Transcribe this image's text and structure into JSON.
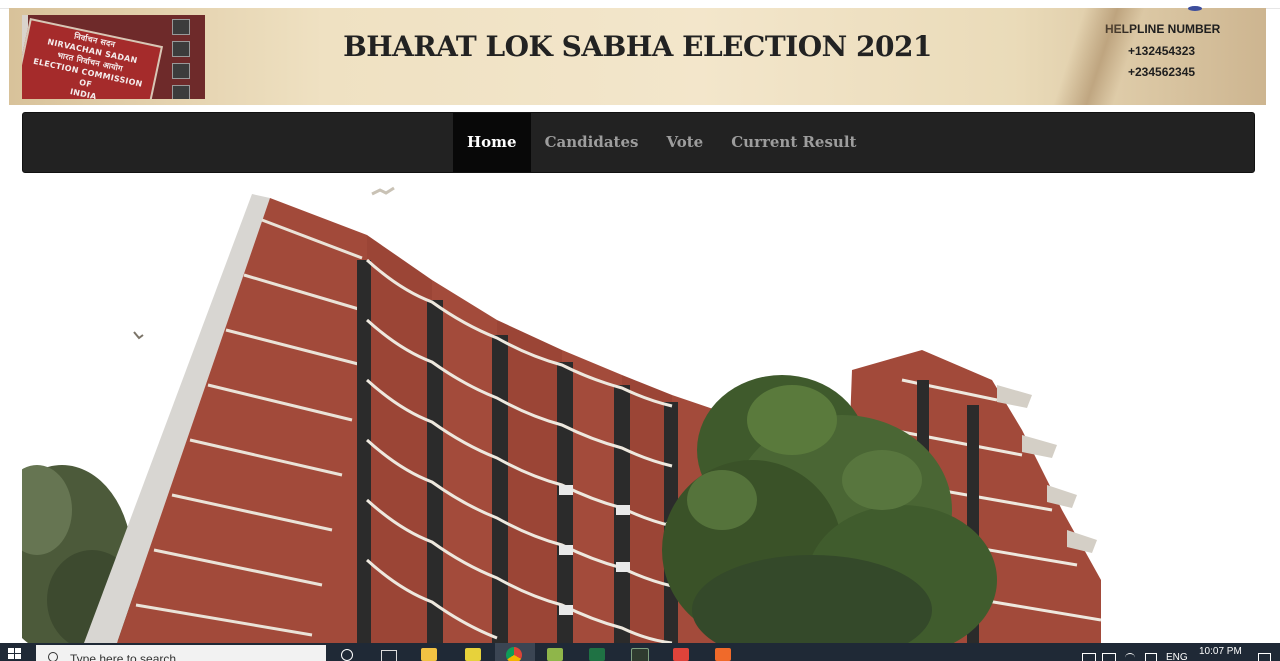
{
  "header": {
    "title": "BHARAT LOK SABHA ELECTION 2021",
    "logo": {
      "lines": [
        "निर्वाचन सदन",
        "NIRVACHAN SADAN",
        "भारत निर्वाचन आयोग",
        "ELECTION COMMISSION",
        "OF",
        "INDIA"
      ]
    },
    "helpline": {
      "label": "HELPLINE NUMBER",
      "numbers": [
        "+132454323",
        "+234562345"
      ]
    }
  },
  "nav": {
    "items": [
      {
        "label": "Home",
        "active": true
      },
      {
        "label": "Candidates",
        "active": false
      },
      {
        "label": "Vote",
        "active": false
      },
      {
        "label": "Current Result",
        "active": false
      }
    ]
  },
  "taskbar": {
    "search_placeholder": "Type here to search",
    "language": "ENG",
    "time": "10:07 PM"
  },
  "colors": {
    "navbar_bg": "#222222",
    "nav_active_bg": "#080808",
    "nav_text": "#9d9d9d",
    "building_brick": "#a24a3a",
    "taskbar_bg": "#1f2936"
  }
}
